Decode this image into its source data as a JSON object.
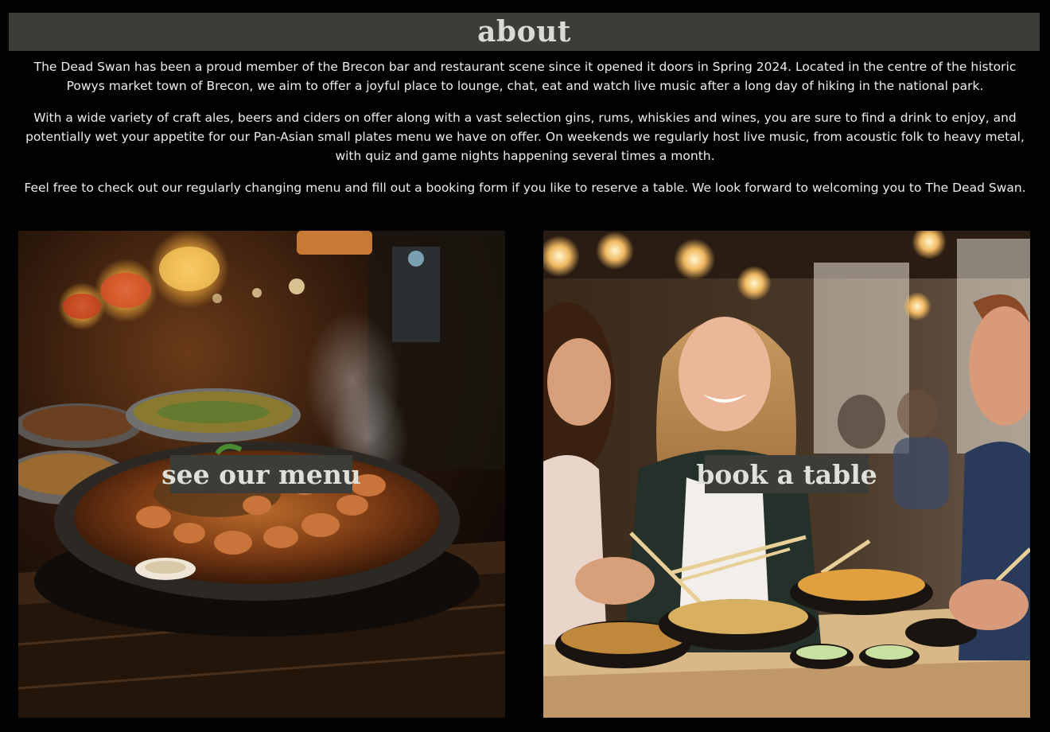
{
  "about": {
    "heading": "about",
    "paragraphs": [
      "The Dead Swan has been a proud member of the Brecon bar and restaurant scene since it opened it doors in Spring 2024. Located in the centre of the historic Powys market town of Brecon, we aim to offer a joyful place to lounge, chat, eat and watch live music after a long day of hiking in the national park.",
      "With a wide variety of craft ales, beers and ciders on offer along with a vast selection gins, rums, whiskies and wines, you are sure to find a drink to enjoy, and potentially wet your appetite for our Pan-Asian small plates menu we have on offer. On weekends we regularly host live music, from acoustic folk to heavy metal, with quiz and game nights happening several times a month.",
      "Feel free to check out our regularly changing menu and fill out a booking form if you like to reserve a table. We look forward to welcoming you to The Dead Swan."
    ]
  },
  "cards": {
    "menu_label": "see our menu",
    "book_label": "book a table"
  },
  "colors": {
    "page_bg": "#020202",
    "bar_bg": "#3c3d38",
    "heading_text": "#d9dad4",
    "body_text": "#ececea"
  }
}
